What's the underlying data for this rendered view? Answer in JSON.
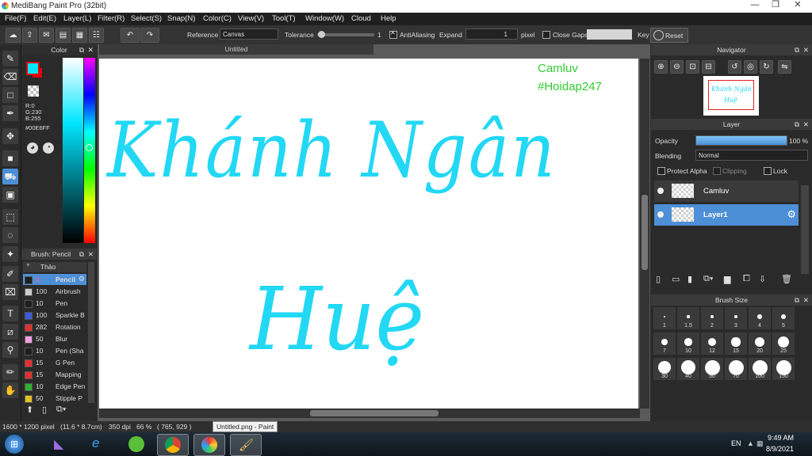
{
  "window": {
    "title": "MediBang Paint Pro (32bit)",
    "min": "—",
    "max": "❐",
    "close": "✕"
  },
  "menu": [
    "File(F)",
    "Edit(E)",
    "Layer(L)",
    "Filter(R)",
    "Select(S)",
    "Snap(N)",
    "Color(C)",
    "View(V)",
    "Tool(T)",
    "Window(W)",
    "Cloud",
    "Help"
  ],
  "toolbar": {
    "reference_label": "Reference",
    "reference_value": "Canvas",
    "tolerance_label": "Tolerance",
    "tolerance_value": "1",
    "tolerance_level": 0.02,
    "antialiasing_label": "AntiAliasing",
    "expand_label": "Expand",
    "expand_value": "1",
    "pixel_label": "pixel",
    "close_gaps_label": "Close Gaps",
    "key_label": "Key",
    "reset_label": "Reset"
  },
  "color_panel": {
    "title": "Color",
    "rgb_r": "R:0",
    "rgb_g": "G:230",
    "rgb_b": "B:255",
    "hex": "#00E6FF",
    "foreground": "#00e6ff",
    "background": "#e60000"
  },
  "brush_panel": {
    "title": "Brush: Pencil",
    "group": "Thảo",
    "items": [
      {
        "size": "4",
        "name": "Pencil",
        "color": "#1e1e1e",
        "selected": true
      },
      {
        "size": "100",
        "name": "Airbrush",
        "color": "#cccccc"
      },
      {
        "size": "10",
        "name": "Pen",
        "color": "#1e1e1e"
      },
      {
        "size": "100",
        "name": "Sparkle B",
        "color": "#3a5bdb"
      },
      {
        "size": "282",
        "name": "Rotation",
        "color": "#e03030"
      },
      {
        "size": "50",
        "name": "Blur",
        "color": "#f0a0e0"
      },
      {
        "size": "10",
        "name": "Pen (Sha",
        "color": "#1e1e1e"
      },
      {
        "size": "15",
        "name": "G Pen",
        "color": "#e03030"
      },
      {
        "size": "15",
        "name": "Mapping",
        "color": "#e03030"
      },
      {
        "size": "10",
        "name": "Edge Pen",
        "color": "#30b030"
      },
      {
        "size": "50",
        "name": "Stipple P",
        "color": "#e0c020"
      }
    ]
  },
  "document": {
    "tab": "Untitled",
    "watermark_line1": "Camluv",
    "watermark_line2": "#Hoidap247",
    "ink_line1": "Khánh Ngân",
    "ink_line2": "Huệ",
    "ink_color": "#22d8f4"
  },
  "navigator": {
    "title": "Navigator"
  },
  "layer_panel": {
    "title": "Layer",
    "opacity_label": "Opacity",
    "opacity_value": "100 %",
    "opacity_level": 1.0,
    "blending_label": "Blending",
    "blending_value": "Normal",
    "protect_alpha": "Protect Alpha",
    "clipping": "Clipping",
    "lock": "Lock",
    "layers": [
      {
        "name": "Camluv",
        "selected": false
      },
      {
        "name": "Layer1",
        "selected": true
      }
    ]
  },
  "brush_size": {
    "title": "Brush Size",
    "sizes": [
      "1",
      "1.5",
      "2",
      "3",
      "4",
      "5",
      "7",
      "10",
      "12",
      "15",
      "20",
      "25",
      "30",
      "40",
      "50",
      "70",
      "100",
      "150"
    ]
  },
  "status": {
    "canvas_size": "1600 * 1200 pixel",
    "physical": "(11.6 * 8.7cm)",
    "dpi": "350 dpi",
    "zoom": "66 %",
    "cursor": "( 765, 929 )",
    "tooltip": "Untitled.png - Paint"
  },
  "taskbar": {
    "lang": "EN",
    "time": "9:49 AM",
    "date": "8/9/2021"
  }
}
